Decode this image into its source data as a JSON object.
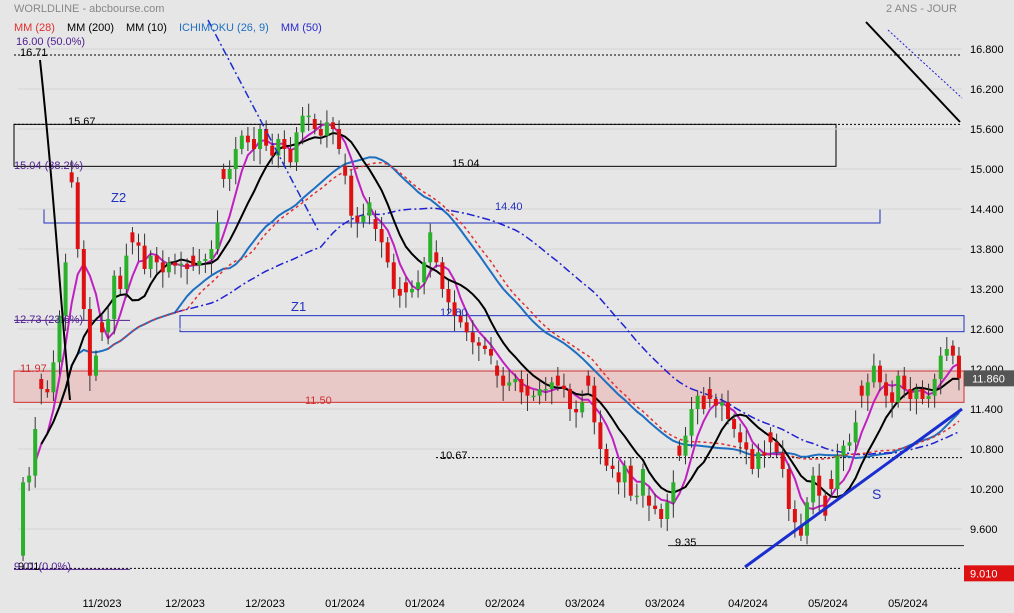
{
  "header": {
    "title": "WORLDLINE - abcbourse.com",
    "period": "2 ANS - JOUR",
    "legend": [
      {
        "label": "MM (28)",
        "color": "#e03030"
      },
      {
        "label": "MM (200)",
        "color": "#000000"
      },
      {
        "label": "MM (10)",
        "color": "#000000"
      },
      {
        "label": "ICHIMOKU (26, 9)",
        "color": "#1f6fc0"
      },
      {
        "label": "MM (50)",
        "color": "#2a2ad0"
      }
    ]
  },
  "colors": {
    "up": "#2bb02b",
    "down": "#dd1111",
    "bg": "#e6e6e6",
    "mm10": "#000000",
    "mm20": "#c020c0",
    "mm28": "#e03030",
    "ichi": "#1f6fc0",
    "mm50": "#2020d0"
  },
  "chart_data": {
    "type": "candlestick",
    "ylim": [
      9.0,
      17.0
    ],
    "y_ticks": [
      "16.800",
      "16.200",
      "15.600",
      "15.000",
      "14.400",
      "13.800",
      "13.200",
      "12.600",
      "12.000",
      "11.400",
      "10.800",
      "10.200",
      "9.600"
    ],
    "x_ticks": [
      "11/2023",
      "12/2023",
      "12/2023",
      "01/2024",
      "01/2024",
      "02/2024",
      "03/2024",
      "03/2024",
      "04/2024",
      "05/2024",
      "05/2024"
    ],
    "last_price": "11.860",
    "low_price": "9.010",
    "levels": [
      {
        "label": "16.71",
        "value": 16.71
      },
      {
        "label": "16.00  (50.0%)",
        "value": 16.9
      },
      {
        "label": "15.67",
        "value": 15.67
      },
      {
        "label": "15.04  (38.2%)",
        "value": 15.04
      },
      {
        "label": "15.04",
        "value": 15.04
      },
      {
        "label": "14.40",
        "value": 14.4
      },
      {
        "label": "12.73  (23.6%)",
        "value": 12.73
      },
      {
        "label": "12.80",
        "value": 12.8
      },
      {
        "label": "11.97",
        "value": 11.97
      },
      {
        "label": "11.50",
        "value": 11.5
      },
      {
        "label": "10.67",
        "value": 10.67
      },
      {
        "label": "9.35",
        "value": 9.35
      },
      {
        "label": "9.01",
        "value": 9.01
      },
      {
        "label": "9.01  (0.0%)",
        "value": 9.01
      }
    ],
    "annotations": [
      "Z2",
      "Z1",
      "S"
    ],
    "close": [
      10.3,
      10.4,
      11.1,
      11.7,
      11.65,
      12.1,
      12.8,
      13.6,
      14.8,
      13.8,
      12.9,
      11.9,
      12.2,
      12.55,
      12.75,
      13.4,
      13.2,
      13.7,
      13.9,
      13.85,
      13.5,
      13.7,
      13.6,
      13.45,
      13.6,
      13.55,
      13.58,
      13.5,
      13.55,
      13.62,
      13.65,
      13.8,
      14.2,
      14.85,
      15.0,
      15.3,
      15.5,
      15.4,
      15.3,
      15.6,
      15.35,
      15.2,
      15.45,
      15.3,
      15.1,
      15.55,
      15.8,
      15.8,
      15.6,
      15.5,
      15.7,
      15.6,
      15.3,
      14.9,
      14.3,
      14.2,
      14.3,
      14.5,
      14.1,
      13.9,
      13.6,
      13.2,
      13.1,
      13.15,
      13.2,
      13.3,
      13.6,
      14.05,
      13.6,
      13.2,
      13.0,
      12.8,
      12.7,
      12.55,
      12.4,
      12.35,
      12.3,
      12.2,
      11.9,
      11.75,
      11.8,
      11.85,
      11.65,
      11.6,
      11.6,
      11.7,
      11.7,
      11.8,
      11.75,
      11.7,
      11.4,
      11.35,
      11.5,
      11.75,
      11.2,
      10.8,
      10.55,
      10.5,
      10.3,
      10.55,
      10.1,
      10.1,
      10.5,
      9.95,
      9.9,
      9.75,
      10.0,
      10.3,
      10.7,
      11.0,
      11.4,
      11.6,
      11.4,
      11.55,
      11.45,
      11.5,
      11.25,
      11.1,
      10.9,
      10.8,
      10.5,
      10.75,
      10.7,
      10.9,
      10.75,
      10.5,
      9.9,
      9.7,
      9.5,
      10.0,
      10.4,
      10.1,
      9.8,
      10.2,
      10.7,
      10.85,
      10.9,
      11.2,
      11.6,
      11.8,
      12.05,
      11.8,
      11.6,
      11.5,
      11.9,
      11.7,
      11.55,
      11.7,
      11.55,
      11.6,
      11.85,
      12.2,
      12.3,
      12.2,
      11.86
    ]
  }
}
